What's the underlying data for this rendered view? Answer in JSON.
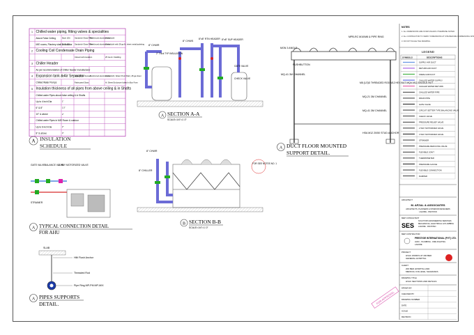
{
  "insulation_schedule": {
    "rows": [
      {
        "no": "1",
        "desc": "Chilled water piping, fitting valves & specialities",
        "a": "",
        "b": "",
        "c": "",
        "d": ""
      },
      {
        "no": "",
        "desc": "Above False Ceiling",
        "a": "Each (25)",
        "b": "Sandwich Glass Fibre",
        "c": "Reinforced aluminum foil",
        "d": "Glass cloth"
      },
      {
        "no": "",
        "desc": "M/E rooms, Plantery shaft & Outdoor",
        "a": "Each (25)",
        "b": "Sandwich Glass Fibre",
        "c": "Reinforced aluminum foil",
        "d": "Glass cloth with 28 ga Al. sheet metal jacketing"
      },
      {
        "no": "2",
        "desc": "Cooling Coil Condensate Drain Piping",
        "a": "",
        "b": "",
        "c": "",
        "d": ""
      },
      {
        "no": "",
        "desc": "",
        "a": "",
        "b": "Closed cell insulation",
        "c": "",
        "d": "25 Ga Al. Cladding"
      },
      {
        "no": "3",
        "desc": "Chiller Header",
        "a": "",
        "b": "",
        "c": "",
        "d": ""
      },
      {
        "no": "",
        "desc": "As per recommendation of Chiller header manufacturer",
        "a": "",
        "b": "",
        "c": "",
        "d": ""
      },
      {
        "no": "4",
        "desc": "Expansion tank & Air Separator",
        "a": "75",
        "b": "Glass Fibre Spread",
        "c": "Reinforced aluminum foil",
        "d": "Glass cloth, Water Proof Paint, 28 ga sheet"
      },
      {
        "no": "",
        "desc": "Chilled Water Pumps",
        "a": "",
        "b": "Fabricated Glass",
        "c": "",
        "d": "Al. Sheet Enclosure bolted in Box Form"
      },
      {
        "no": "5",
        "desc": "Insulation thickness of all pipes from above ceiling & in Shafts",
        "a": "",
        "b": "",
        "c": "",
        "d": ""
      },
      {
        "no": "",
        "desc": "Chilled water Pipes above false ceiling & in Shafts",
        "a": "",
        "b": "",
        "c": "",
        "d": ""
      },
      {
        "no": "",
        "desc": "Up to 4 inch Dia",
        "a": "1\"",
        "b": "",
        "c": "",
        "d": ""
      },
      {
        "no": "",
        "desc": "6\" & 8\"",
        "a": "1.5\"",
        "b": "",
        "c": "",
        "d": ""
      },
      {
        "no": "",
        "desc": "10\" & above",
        "a": "2\"",
        "b": "",
        "c": "",
        "d": ""
      },
      {
        "no": "",
        "desc": "Chilled water Pipes in M/E Room & outdoor",
        "a": "",
        "b": "",
        "c": "",
        "d": ""
      },
      {
        "no": "",
        "desc": "Up to 6 inch Dia",
        "a": "2\"",
        "b": "",
        "c": "",
        "d": ""
      },
      {
        "no": "",
        "desc": "8\" & above",
        "a": "3\"",
        "b": "",
        "c": "",
        "d": ""
      }
    ]
  },
  "details": {
    "insulation": {
      "letter": "A",
      "line1": "INSULATION",
      "line2": "SCHEDULE"
    },
    "section_aa": {
      "letter": "A",
      "title": "SECTION A-A",
      "scale": "SCALE=1/4\"=1'-0\""
    },
    "duct_support": {
      "letter": "A",
      "line1": "DUCT FLOOR MOUNTED",
      "line2": "SUPPORT DETAIL."
    },
    "typical_ahu": {
      "letter": "A",
      "line1": "TYPICAL CONNECTION DETAIL",
      "line2": "FOR AHU"
    },
    "section_bb": {
      "letter": "B",
      "title": "SECTION B-B",
      "scale": "SCALE=1/4\"=1'-0\""
    },
    "pipe_supports": {
      "letter": "A",
      "line1": "PIPES SUPPORTS",
      "line2": "DETAIL."
    }
  },
  "section_aa_labels": {
    "chwr": "8\" CHWR",
    "chwr2": "8\" CHWS",
    "hdr1": "8\"x8\" RTN HEADER",
    "hdr2": "8\"x8\" SUP HEADER",
    "insulation": "2\" Thick TYP INSULATION",
    "gate": "GATE VALVE",
    "check": "CHECK VALVE",
    "sup": "8\" CHWS"
  },
  "duct_labels": {
    "rod": "MPB-RC M10/M8 & PIPE RING",
    "angle": "MGN 3 ANGLE",
    "push": "PUSHBUTTON",
    "ch1": "MQ-41 3M CHANNEL",
    "thread": "M8 (1/2)D THREADED ROD M12 HEX NUT MQA-M12 SADDLE NUT",
    "ch2": "MQ-21 3M CHANNEL",
    "ch3": "MQ-41 3M CHANNEL",
    "anchor": "HSA M12 20/50 STUD ANCHOR"
  },
  "ahu_labels": {
    "gate": "GATE VALVE",
    "balance": "BALANCE VALVE",
    "motor": "2 WAY MOTORIZED VALVE",
    "strainer": "STRAINER"
  },
  "bb_labels": {
    "chws": "8\" CHWR",
    "chiller": "8\" CHILLER",
    "note": "FOR SEE NOTES NO. 1",
    "chwr": "8\" CHWR"
  },
  "support_labels": {
    "slab": "SLAB",
    "anchor": "Hilti Flush Anchor",
    "rod": "Threaded Rod",
    "ring": "Pipe Ring MP-PM MP-MXI"
  },
  "title_block": {
    "notes_heading": "NOTES",
    "notes": [
      "ALL DIMENSIONS ARE IN MM UNLESS OTHERWISE NOTED.",
      "ALL CONTRACTOR TO VERIFY DIMENSIONS AT SITE BEFORE COMMENCING WORK AND REPORT ANY DISCREPANCY.",
      "DO NOT SCALE THE DRAWING."
    ],
    "legend_heading": "LEGEND",
    "legend_cols": [
      "SYMBOLS",
      "DESCRIPTIONS"
    ],
    "legend": [
      {
        "color": "#2a6ed8",
        "desc": "SUPPLY AIR DUCT"
      },
      {
        "color": "#8a2ad8",
        "desc": "RETURN AIR DUCT"
      },
      {
        "color": "#2aa82a",
        "desc": "FRESH AIR DUCT"
      },
      {
        "color": "#2a3ad8",
        "desc": "CHILLED WATER SUPPLY"
      },
      {
        "color": "#d82a8a",
        "desc": "CHILLED WATER RETURN"
      },
      {
        "color": "#1a1a1a",
        "desc": "CHILLED WATER PIPE"
      },
      {
        "color": "#1a1a1a",
        "desc": "DRAIN PIPE"
      },
      {
        "color": "#1a1a1a",
        "desc": "GATE VALVE"
      },
      {
        "color": "#1a1a1a",
        "desc": "CIRCUIT SETTER TYPE BALANCING VALVE"
      },
      {
        "color": "#1a1a1a",
        "desc": "CHECK VALVE"
      },
      {
        "color": "#1a1a1a",
        "desc": "PRESSURE RELIEF VALVE"
      },
      {
        "color": "#1a1a1a",
        "desc": "2 WAY MOTORIZED VALVE"
      },
      {
        "color": "#1a1a1a",
        "desc": "3 WAY MOTORIZED VALVE"
      },
      {
        "color": "#1a1a1a",
        "desc": "STRAINER"
      },
      {
        "color": "#1a1a1a",
        "desc": "PRESSURE REDUCING VALVE"
      },
      {
        "color": "#1a1a1a",
        "desc": "FLEXIBLE JOINT"
      },
      {
        "color": "#1a1a1a",
        "desc": "THERMOMETER"
      },
      {
        "color": "#1a1a1a",
        "desc": "PRESSURE GAUGE"
      },
      {
        "color": "#1a1a1a",
        "desc": "FLEXIBLE CONNECTION"
      },
      {
        "color": "#1a1a1a",
        "desc": "DAMPER"
      }
    ],
    "architect_heading": "ARCHITECT",
    "architect_name": "M. AFZAL & ASSOCIATES",
    "architect_lines": [
      "ARCHITECTS, PLANNERS & INTERIOR DESIGNERS",
      "LAHORE - PAKISTAN"
    ],
    "consultant_heading": "MEP CONSULTANT",
    "consultant_logo": "SES",
    "consultant_lines": [
      "SOLUTIONS ENGINEERING SERVICES",
      "MECHANICAL, ELECTRICAL & PLUMBING",
      "LAHORE - PAKISTAN"
    ],
    "contractor_heading": "MEP CONTRACTOR",
    "contractor_name": "PRESTIGE INTERNATIONAL (PVT) LTD.",
    "contractor_lines": [
      "HVAC - PLUMBING - FIRE FIGHTING",
      "LAHORE"
    ],
    "project_heading": "PROJECT",
    "project_lines": [
      "HVAC WORKS AT 200 BED",
      "GENERAL HOSPITAL"
    ],
    "client_heading": "CLIENT",
    "client_lines": [
      "200 BED HOSPITAL AND",
      "MEDICAL COLLEGE, SHAHDARA"
    ],
    "drawing_heading": "DRAWING TITLE",
    "drawing_title": "HVAC SECTIONS AND DETAILS",
    "info_rows": [
      "DRAWN BY",
      "CHECKED BY",
      "DRAWING NUMBER",
      "DATE",
      "SCALE",
      "REVISION"
    ],
    "stamp": "FOR APPROVAL"
  }
}
